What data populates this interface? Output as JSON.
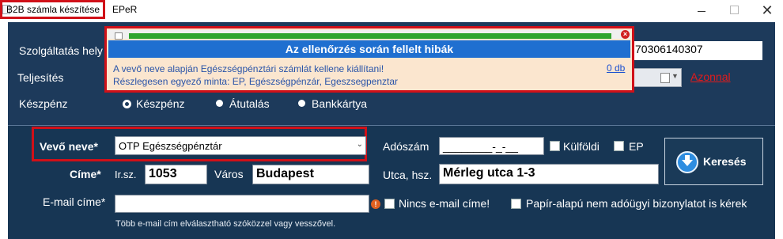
{
  "window": {
    "title": "B2B számla készítése",
    "title_suffix": "EPeR"
  },
  "top_section": {
    "service_label": "Szolgáltatás hely",
    "service_value": "70306140307",
    "fulfillment_label": "Teljesítés",
    "immediate_link": "Azonnal",
    "payment_label": "Készpénz",
    "payment_options": [
      "Készpénz",
      "Átutalás",
      "Bankkártya"
    ],
    "payment_selected": "Készpénz"
  },
  "popup": {
    "header": "Az ellenőrzés során fellelt hibák",
    "line1": "A vevő neve alapján Egészségpénztári számlát kellene kiállítani!",
    "line2": "Részlegesen egyező minta: EP, Egészségpénzár, Egeszsegpenztar",
    "count_link": "0 db"
  },
  "buyer": {
    "name_label": "Vevő neve*",
    "name_value": "OTP Egészségpénztár",
    "tax_label": "Adószám",
    "tax_value": "________-_-__",
    "foreign_label": "Külföldi",
    "ep_label": "EP",
    "address_label": "Címe*",
    "zip_label": "Ir.sz.",
    "zip_value": "1053",
    "city_label": "Város",
    "city_value": "Budapest",
    "street_label": "Utca, hsz.",
    "street_value": "Mérleg utca 1-3",
    "email_label": "E-mail címe*",
    "email_value": "",
    "no_email_label": "Nincs e-mail címe!",
    "paper_label": "Papír-alapú nem adóügyi bizonylatot is kérek",
    "email_hint": "Több e-mail cím elválasztható szóközzel vagy vesszővel.",
    "search_button": "Keresés"
  },
  "colors": {
    "panel": "#1d3a5b",
    "highlight": "#d01018",
    "popup_header": "#1f6fd0",
    "popup_bg": "#fbe6cf"
  }
}
